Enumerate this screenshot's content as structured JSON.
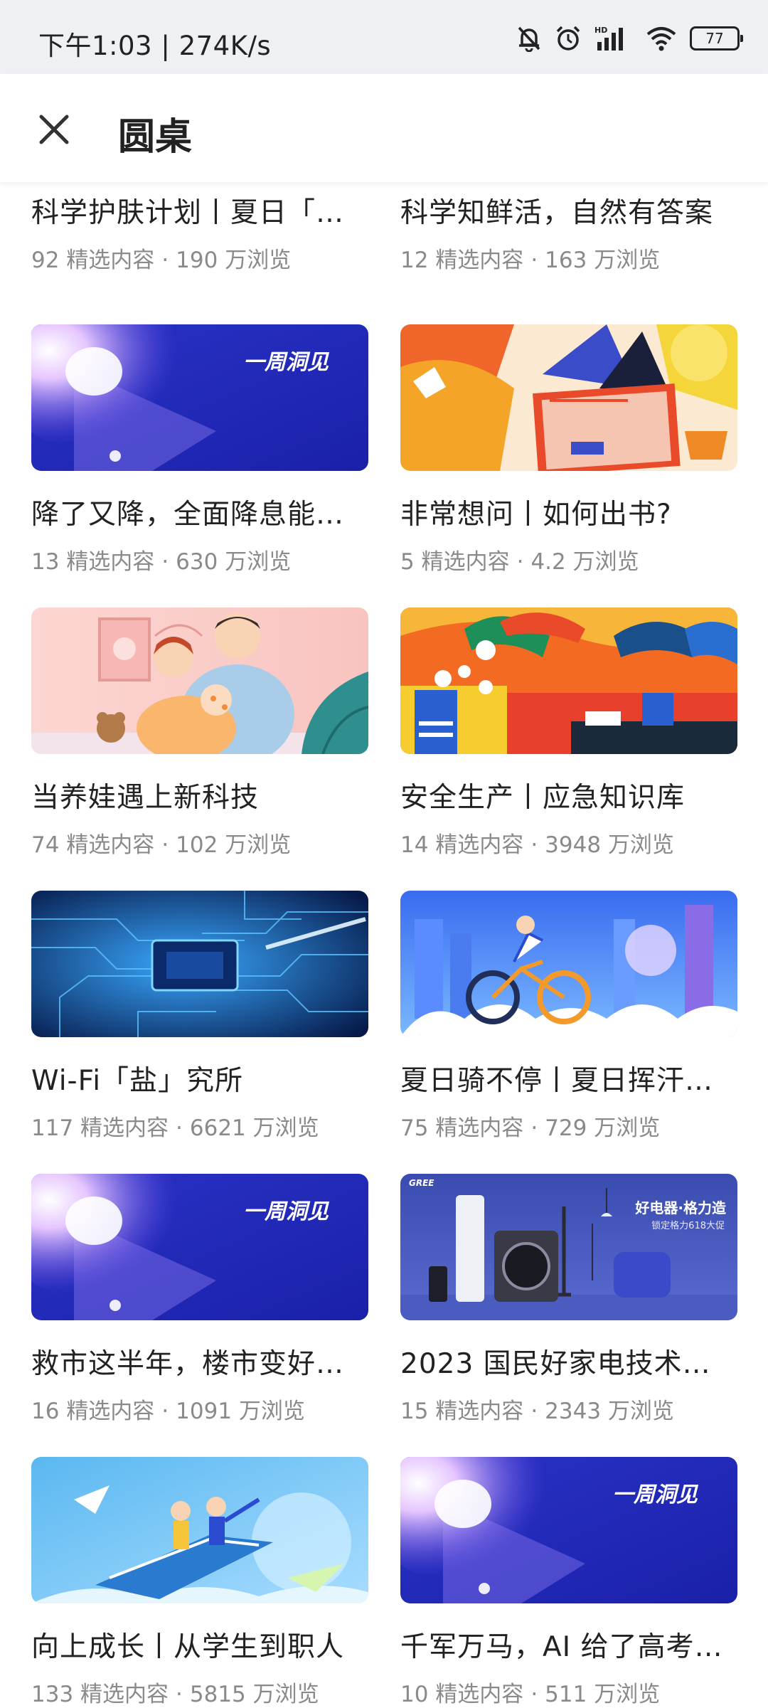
{
  "status_bar": {
    "time": "下午1:03 | 274K/s",
    "battery": "77",
    "icons": [
      "mute-bell-icon",
      "alarm-icon",
      "hd-signal-icon",
      "wifi-icon",
      "battery-icon"
    ]
  },
  "header": {
    "title": "圆桌",
    "close_icon": "close-icon"
  },
  "meta_units": {
    "featured": "精选内容",
    "views": "万浏览",
    "separator": "·"
  },
  "cards": [
    {
      "title": "科学护肤计划丨夏日「…",
      "count": "92",
      "views": "190",
      "thumb": "partial"
    },
    {
      "title": "科学知鲜活，自然有答案",
      "count": "12",
      "views": "163",
      "thumb": "partial"
    },
    {
      "title": "降了又降，全面降息能…",
      "count": "13",
      "views": "630",
      "thumb": "spotlight",
      "brand": "一周洞见"
    },
    {
      "title": "非常想问丨如何出书?",
      "count": "5",
      "views": "4.2",
      "thumb": "writer"
    },
    {
      "title": "当养娃遇上新科技",
      "count": "74",
      "views": "102",
      "thumb": "family"
    },
    {
      "title": "安全生产丨应急知识库",
      "count": "14",
      "views": "3948",
      "thumb": "safety"
    },
    {
      "title": "Wi-Fi「盐」究所",
      "count": "117",
      "views": "6621",
      "thumb": "circuit"
    },
    {
      "title": "夏日骑不停丨夏日挥汗…",
      "count": "75",
      "views": "729",
      "thumb": "cyclist"
    },
    {
      "title": "救市这半年，楼市变好…",
      "count": "16",
      "views": "1091",
      "thumb": "spotlight",
      "brand": "一周洞见"
    },
    {
      "title": "2023 国民好家电技术…",
      "count": "15",
      "views": "2343",
      "thumb": "appliance",
      "brand": "好电器·格力造",
      "sub": "锁定格力618大促",
      "logo": "GREE"
    },
    {
      "title": "向上成长丨从学生到职人",
      "count": "133",
      "views": "5815",
      "thumb": "growth"
    },
    {
      "title": "千军万马，AI 给了高考…",
      "count": "10",
      "views": "511",
      "thumb": "spotlight",
      "brand": "一周洞见"
    }
  ]
}
